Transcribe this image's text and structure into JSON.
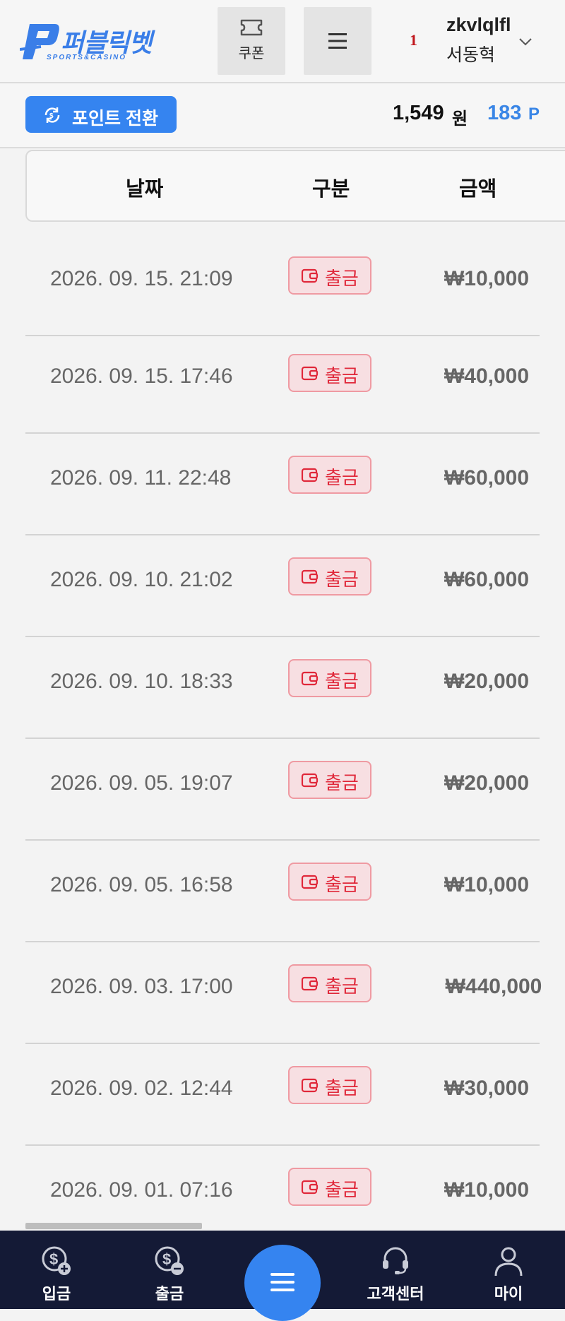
{
  "header": {
    "logo_text": "퍼블릭벳",
    "logo_sub": "SPORTS&CASINO",
    "coupon_label": "쿠폰",
    "user": {
      "level": "1",
      "username": "zkvlqlfl",
      "realname": "서동혁"
    }
  },
  "points_bar": {
    "convert_label": "포인트 전환",
    "balance": "1,549",
    "balance_unit": "원",
    "points": "183",
    "points_unit": "P"
  },
  "table": {
    "headers": [
      "날짜",
      "구분",
      "금액"
    ],
    "rows": [
      {
        "date": "2026. 09. 15. 21:09",
        "type": "출금",
        "amount": "₩10,000"
      },
      {
        "date": "2026. 09. 15. 17:46",
        "type": "출금",
        "amount": "₩40,000"
      },
      {
        "date": "2026. 09. 11. 22:48",
        "type": "출금",
        "amount": "₩60,000"
      },
      {
        "date": "2026. 09. 10. 21:02",
        "type": "출금",
        "amount": "₩60,000"
      },
      {
        "date": "2026. 09. 10. 18:33",
        "type": "출금",
        "amount": "₩20,000"
      },
      {
        "date": "2026. 09. 05. 19:07",
        "type": "출금",
        "amount": "₩20,000"
      },
      {
        "date": "2026. 09. 05. 16:58",
        "type": "출금",
        "amount": "₩10,000"
      },
      {
        "date": "2026. 09. 03. 17:00",
        "type": "출금",
        "amount": "₩440,000"
      },
      {
        "date": "2026. 09. 02. 12:44",
        "type": "출금",
        "amount": "₩30,000"
      },
      {
        "date": "2026. 09. 01. 07:16",
        "type": "출금",
        "amount": "₩10,000"
      }
    ]
  },
  "bottom_nav": {
    "deposit": "입금",
    "withdraw": "출금",
    "support": "고객센터",
    "my": "마이"
  },
  "colors": {
    "accent": "#3584f0",
    "nav_bg": "#141a36",
    "withdraw_red": "#e0283a"
  }
}
